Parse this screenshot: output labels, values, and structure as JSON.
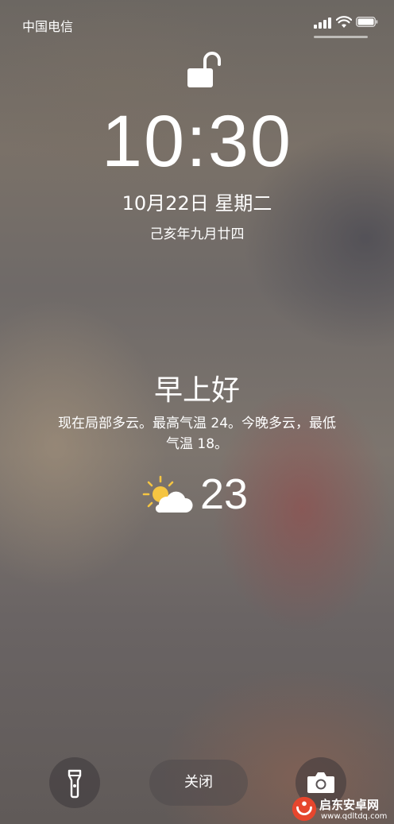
{
  "status_bar": {
    "carrier": "中国电信"
  },
  "lockscreen": {
    "time": "10:30",
    "date": "10月22日 星期二",
    "lunar_date": "己亥年九月廿四"
  },
  "weather": {
    "greeting": "早上好",
    "forecast_line1": "现在局部多云。最高气温 24。今晚多云，最低",
    "forecast_line2": "气温 18。",
    "icon": "partly-sunny-icon",
    "temperature": "23"
  },
  "bottom": {
    "close_label": "关闭",
    "left_icon": "flashlight-icon",
    "right_icon": "camera-icon"
  },
  "watermark": {
    "name": "启东安卓网",
    "url": "www.qdltdq.com"
  },
  "colors": {
    "sun": "#f5c542",
    "watermark_red": "#e6462d"
  }
}
